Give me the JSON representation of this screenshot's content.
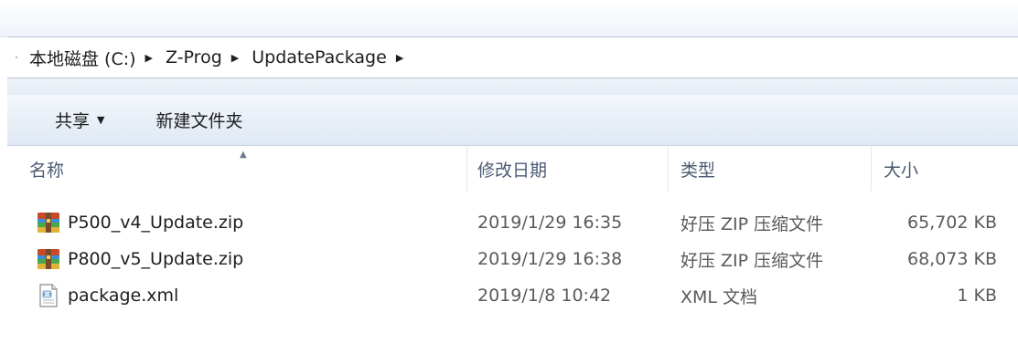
{
  "address": {
    "crumbs": [
      "本地磁盘 (C:)",
      "Z-Prog",
      "UpdatePackage"
    ]
  },
  "toolbar": {
    "share_label": "共享",
    "new_folder_label": "新建文件夹"
  },
  "columns": {
    "name": "名称",
    "date": "修改日期",
    "type": "类型",
    "size": "大小"
  },
  "files": [
    {
      "name": "P500_v4_Update.zip",
      "date": "2019/1/29 16:35",
      "type": "好压 ZIP 压缩文件",
      "size": "65,702 KB",
      "icon": "zip-archive-icon"
    },
    {
      "name": "P800_v5_Update.zip",
      "date": "2019/1/29 16:38",
      "type": "好压 ZIP 压缩文件",
      "size": "68,073 KB",
      "icon": "zip-archive-icon"
    },
    {
      "name": "package.xml",
      "date": "2019/1/8 10:42",
      "type": "XML 文档",
      "size": "1 KB",
      "icon": "xml-file-icon"
    }
  ]
}
